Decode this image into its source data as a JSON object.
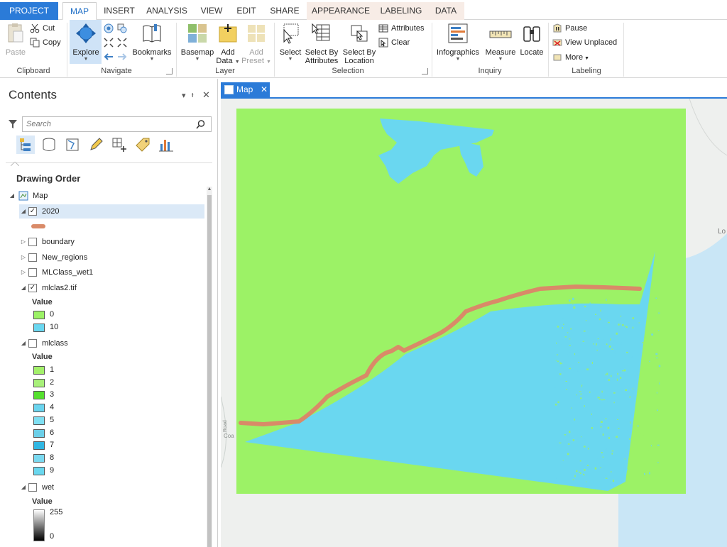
{
  "ribbon_tabs": [
    {
      "label": "PROJECT"
    },
    {
      "label": "MAP"
    },
    {
      "label": "INSERT"
    },
    {
      "label": "ANALYSIS"
    },
    {
      "label": "VIEW"
    },
    {
      "label": "EDIT"
    },
    {
      "label": "SHARE"
    },
    {
      "label": "APPEARANCE"
    },
    {
      "label": "LABELING"
    },
    {
      "label": "DATA"
    }
  ],
  "ribbon": {
    "clipboard": {
      "paste": "Paste",
      "cut": "Cut",
      "copy": "Copy",
      "label": "Clipboard"
    },
    "navigate": {
      "explore": "Explore",
      "bookmarks": "Bookmarks",
      "label": "Navigate"
    },
    "layer": {
      "basemap": "Basemap",
      "add_data_1": "Add",
      "add_data_2": "Data",
      "add_preset_1": "Add",
      "add_preset_2": "Preset",
      "label": "Layer"
    },
    "selection": {
      "select": "Select",
      "select_by_attr_1": "Select By",
      "select_by_attr_2": "Attributes",
      "select_by_loc_1": "Select By",
      "select_by_loc_2": "Location",
      "attributes": "Attributes",
      "clear": "Clear",
      "label": "Selection"
    },
    "inquiry": {
      "infographics": "Infographics",
      "measure": "Measure",
      "locate": "Locate",
      "label": "Inquiry"
    },
    "labeling": {
      "pause": "Pause",
      "view_unplaced": "View Unplaced",
      "more": "More",
      "label": "Labeling"
    }
  },
  "contents": {
    "title": "Contents",
    "search_placeholder": "Search",
    "drawing_order": "Drawing Order",
    "map_label": "Map",
    "layers": [
      {
        "name": "2020",
        "checked": true,
        "expanded": true
      },
      {
        "name": "boundary",
        "checked": false,
        "expanded": false
      },
      {
        "name": "New_regions",
        "checked": false,
        "expanded": false
      },
      {
        "name": "MLClass_wet1",
        "checked": false,
        "expanded": false
      },
      {
        "name": "mlclas2.tif",
        "checked": true,
        "expanded": true
      },
      {
        "name": "mlclass",
        "checked": false,
        "expanded": true
      },
      {
        "name": "wet",
        "checked": false,
        "expanded": true
      }
    ],
    "layer_2020_symbol_color": "#d98a68",
    "mlclas2_legend": {
      "heading": "Value",
      "items": [
        {
          "label": "0",
          "color": "#9cf266"
        },
        {
          "label": "10",
          "color": "#6ad7f0"
        }
      ]
    },
    "mlclass_legend": {
      "heading": "Value",
      "items": [
        {
          "label": "1",
          "color": "#a3f06a"
        },
        {
          "label": "2",
          "color": "#a8f07a"
        },
        {
          "label": "3",
          "color": "#55e02e"
        },
        {
          "label": "4",
          "color": "#6ad4ee"
        },
        {
          "label": "5",
          "color": "#7fdff2"
        },
        {
          "label": "6",
          "color": "#6ccfe8"
        },
        {
          "label": "7",
          "color": "#31b7e3"
        },
        {
          "label": "8",
          "color": "#7ad9f0"
        },
        {
          "label": "9",
          "color": "#6ad7ee"
        }
      ]
    },
    "wet_legend": {
      "heading": "Value",
      "max": "255",
      "min": "0"
    }
  },
  "map_tab": {
    "label": "Map"
  },
  "map": {
    "colors": {
      "land": "#9cf266",
      "water": "#6ad7f0",
      "shoreline": "#d98a68",
      "ocean_basemap": "#c9e6f6",
      "land_basemap": "#eef0ee"
    },
    "basemap_labels": {
      "road": "Road",
      "coast": "Coa",
      "east_edge": "Lo"
    }
  }
}
